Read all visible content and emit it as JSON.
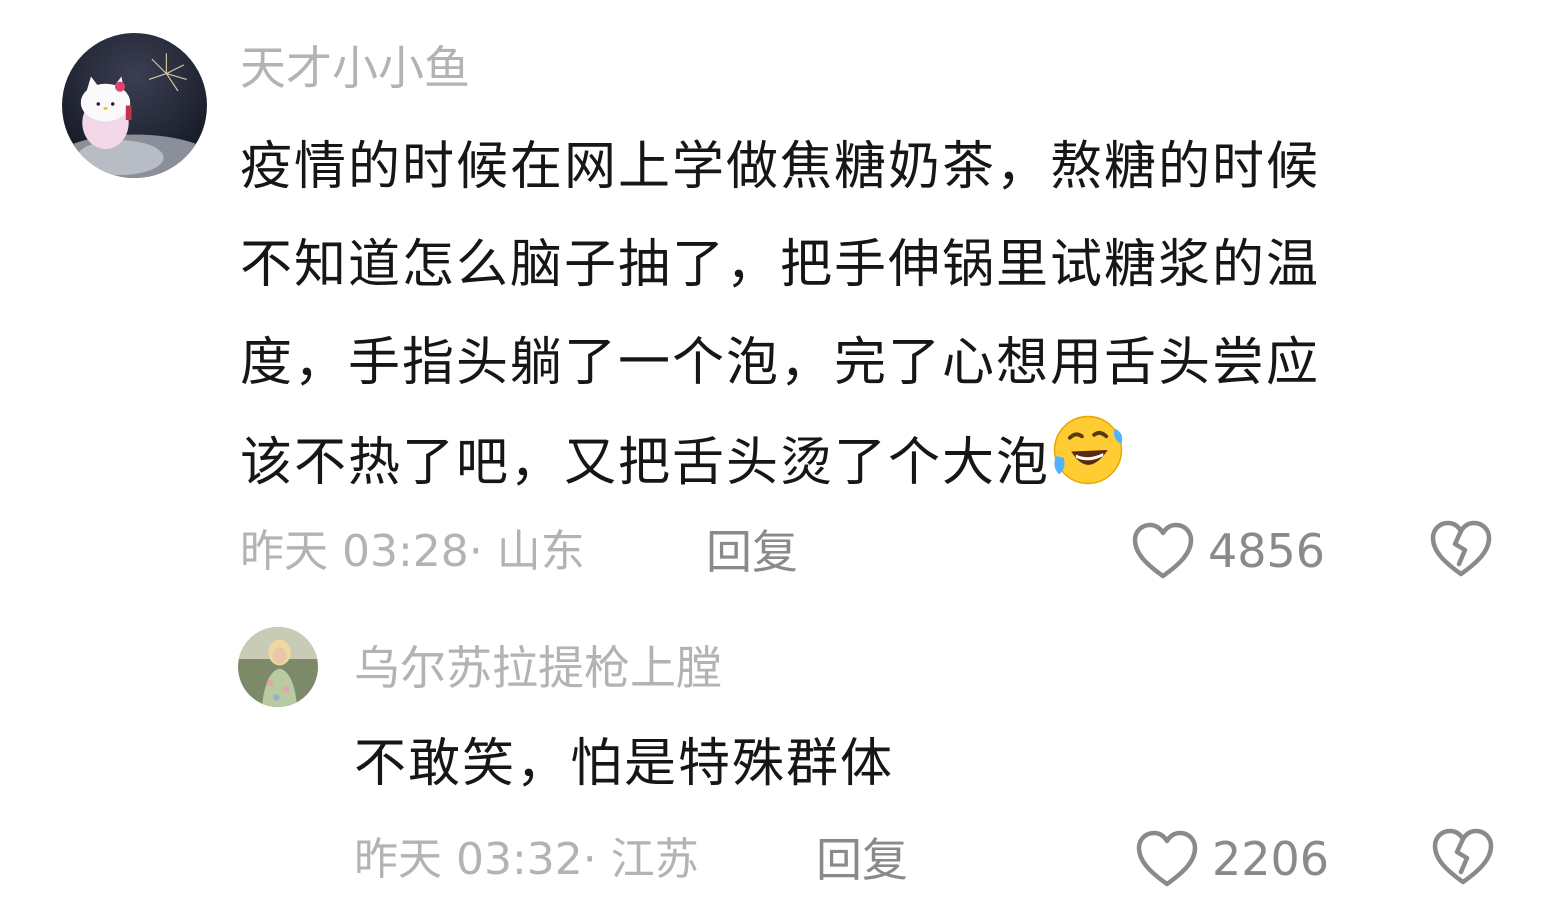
{
  "comments": [
    {
      "username": "天才小小鱼",
      "lines": [
        "疫情的时候在网上学做焦糖奶茶，熬糖的时候",
        "不知道怎么脑子抽了，把手伸锅里试糖浆的温",
        "度，手指头躺了一个泡，完了心想用舌头尝应",
        "该不热了吧，又把舌头烫了个大泡"
      ],
      "emoji": "rolling-on-floor-laughing-emoji",
      "meta": "昨天 03:28· 山东",
      "reply_label": "回复",
      "likes": "4856",
      "avatar_icon": "hello-kitty-avatar"
    },
    {
      "username": "乌尔苏拉提枪上膛",
      "lines": [
        "不敢笑，怕是特殊群体"
      ],
      "meta": "昨天 03:32· 江苏",
      "reply_label": "回复",
      "likes": "2206",
      "avatar_icon": "user-photo-avatar"
    }
  ],
  "icons": {
    "like": "heart-outline-icon",
    "dislike": "broken-heart-icon"
  },
  "colors": {
    "username": "#b3b3b3",
    "content": "#161616",
    "meta": "#b3b3b3",
    "action": "#8a8a8a"
  }
}
